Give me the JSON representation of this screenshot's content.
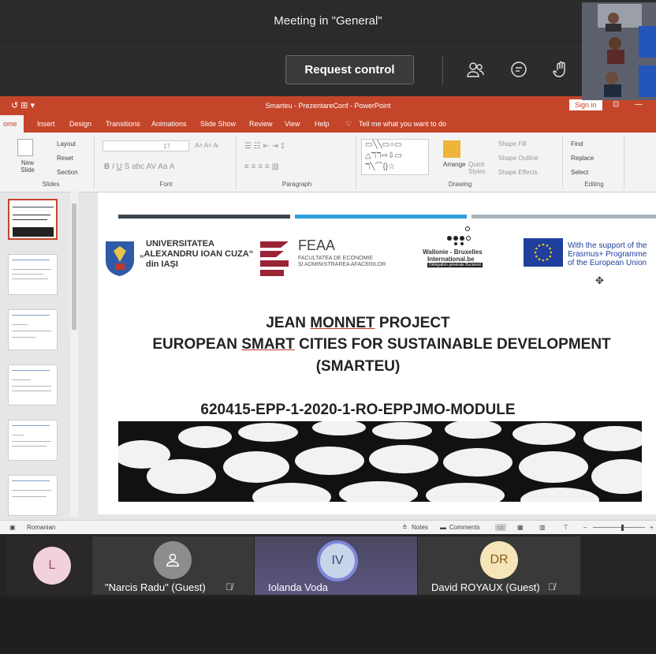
{
  "meeting": {
    "title": "Meeting in \"General\""
  },
  "toolbar": {
    "request_control": "Request control"
  },
  "powerpoint": {
    "doc_title": "Smarteu - PrezentareConf - PowerPoint",
    "sign_in": "Sign in",
    "tabs": [
      "ome",
      "Insert",
      "Design",
      "Transitions",
      "Animations",
      "Slide Show",
      "Review",
      "View",
      "Help"
    ],
    "tell_me": "Tell me what you want to do",
    "ribbon": {
      "slides_group": "Slides",
      "font_group": "Font",
      "paragraph_group": "Paragraph",
      "drawing_group": "Drawing",
      "editing_group": "Editing",
      "new_slide": "New Slide",
      "layout": "Layout",
      "reset": "Reset",
      "section": "Section",
      "arrange": "Arrange",
      "quick_styles": "Quick Styles",
      "shape_fill": "Shape Fill",
      "shape_outline": "Shape Outline",
      "shape_effects": "Shape Effects",
      "find": "Find",
      "replace": "Replace",
      "select": "Select",
      "font_size": "17"
    },
    "status": {
      "language": "Romanian",
      "notes": "Notes",
      "comments": "Comments"
    }
  },
  "slide": {
    "uni_line1": "UNIVERSITATEA",
    "uni_line2": "„ALEXANDRU IOAN CUZA“",
    "uni_line3": "din IAȘI",
    "feaa_big": "FEAA",
    "feaa_line1": "FACULTATEA DE ECONOMIE",
    "feaa_line2": "ȘI ADMINISTRAREA AFACERILOR",
    "wbi_line1": "Wallonie - Bruxelles",
    "wbi_line2": "International.be",
    "wbi_line3": "Délégation générale Bucarest",
    "eu_line1": "With the support of the",
    "eu_line2": "Erasmus+ Programme",
    "eu_line3": "of the European Union",
    "title_line1_pre": "JEAN ",
    "title_line1_ul": "MONNET",
    "title_line1_post": " PROJECT",
    "title_line2_pre": "EUROPEAN ",
    "title_line2_ul": "SMART",
    "title_line2_post": " CITIES FOR SUSTAINABLE DEVELOPMENT",
    "title_line3": "(SMARTEU)",
    "code": "620415-EPP-1-2020-1-RO-EPPJMO-MODULE"
  },
  "participants": [
    {
      "initials": "L",
      "name": ""
    },
    {
      "initials": "",
      "name": "\"Narcis Radu\" (Guest)"
    },
    {
      "initials": "IV",
      "name": "Iolanda Voda"
    },
    {
      "initials": "DR",
      "name": "David ROYAUX (Guest)"
    }
  ],
  "colors": {
    "ppt_accent": "#c4452a",
    "bar_dark": "#3b4650",
    "bar_blue": "#2d9fe0",
    "bar_grey": "#a8b3bf"
  }
}
